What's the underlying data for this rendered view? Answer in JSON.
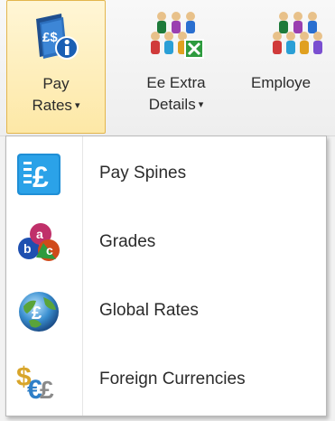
{
  "ribbon": {
    "pay_rates": {
      "line1": "Pay",
      "line2": "Rates",
      "caret": "▾",
      "icon": "pay-rates-icon"
    },
    "ee_extra": {
      "line1": "Ee Extra",
      "line2": "Details",
      "caret": "▾",
      "icon": "employee-extra-details-icon"
    },
    "employee": {
      "line1": "Employe",
      "icon": "employees-icon"
    }
  },
  "menu": {
    "items": [
      {
        "label": "Pay Spines",
        "icon": "pay-spines-icon"
      },
      {
        "label": "Grades",
        "icon": "grades-icon"
      },
      {
        "label": "Global Rates",
        "icon": "global-rates-icon"
      },
      {
        "label": "Foreign Currencies",
        "icon": "foreign-currencies-icon"
      }
    ]
  },
  "colors": {
    "active_button_bg": "#fde8a6",
    "active_button_border": "#e3b64d",
    "menu_bg": "#ffffff",
    "text": "#2b2b2b"
  }
}
